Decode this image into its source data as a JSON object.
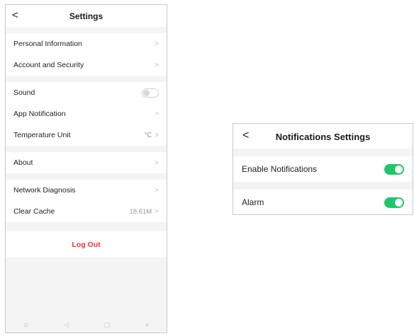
{
  "settings": {
    "title": "Settings",
    "back_icon": "‹",
    "items": {
      "personal_info": "Personal Information",
      "account_security": "Account and Security",
      "sound": "Sound",
      "app_notification": "App Notification",
      "temperature_unit": "Temperature Unit",
      "temperature_value": "℃",
      "about": "About",
      "network_diagnosis": "Network Diagnosis",
      "clear_cache": "Clear Cache",
      "cache_size": "18.61M"
    },
    "sound_enabled": false,
    "logout_label": "Log Out"
  },
  "navbar": {
    "home_glyph": "⊙",
    "back_glyph": "◁",
    "recents_glyph": "▢",
    "menu_glyph": "≡"
  },
  "notifications": {
    "title": "Notifications Settings",
    "enable_label": "Enable Notifications",
    "enable_on": true,
    "alarm_label": "Alarm",
    "alarm_on": true
  },
  "colors": {
    "accent_green": "#1fc66a",
    "logout_red": "#e53935"
  }
}
